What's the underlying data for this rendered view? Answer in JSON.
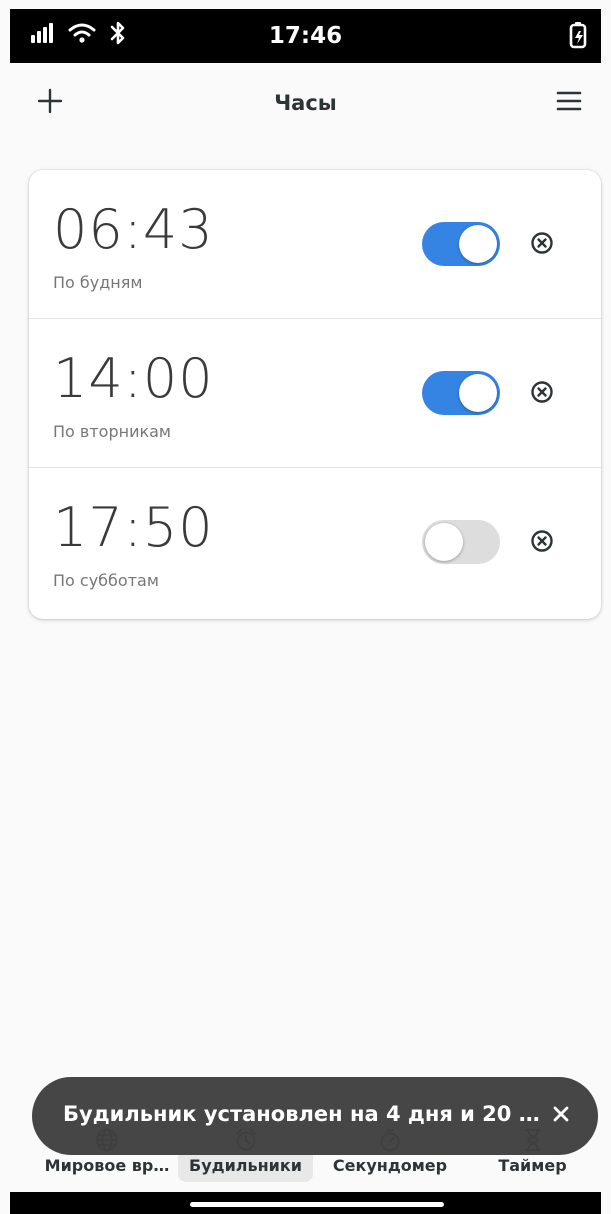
{
  "status_bar": {
    "time": "17:46",
    "icons": [
      "signal-icon",
      "wifi-icon",
      "bluetooth-icon",
      "battery-charging-icon"
    ]
  },
  "header": {
    "title": "Часы",
    "add_icon": "plus-icon",
    "menu_icon": "hamburger-menu-icon"
  },
  "alarms": [
    {
      "time": "06:43",
      "repeat": "По будням",
      "enabled": true
    },
    {
      "time": "14:00",
      "repeat": "По вторникам",
      "enabled": true
    },
    {
      "time": "17:50",
      "repeat": "По субботам",
      "enabled": false
    }
  ],
  "toast": {
    "message": "Будильник установлен на 4 дня и 20 …",
    "close_label": "✕"
  },
  "nav": {
    "tabs": [
      {
        "label": "Мировое вр…",
        "icon": "globe-icon",
        "active": false
      },
      {
        "label": "Будильники",
        "icon": "alarm-clock-icon",
        "active": true
      },
      {
        "label": "Секундомер",
        "icon": "stopwatch-icon",
        "active": false
      },
      {
        "label": "Таймер",
        "icon": "hourglass-icon",
        "active": false
      }
    ]
  },
  "colors": {
    "accent": "#3584e4",
    "toggle_off": "#dddddd",
    "toast_bg": "#404040",
    "background": "#fafafa"
  }
}
